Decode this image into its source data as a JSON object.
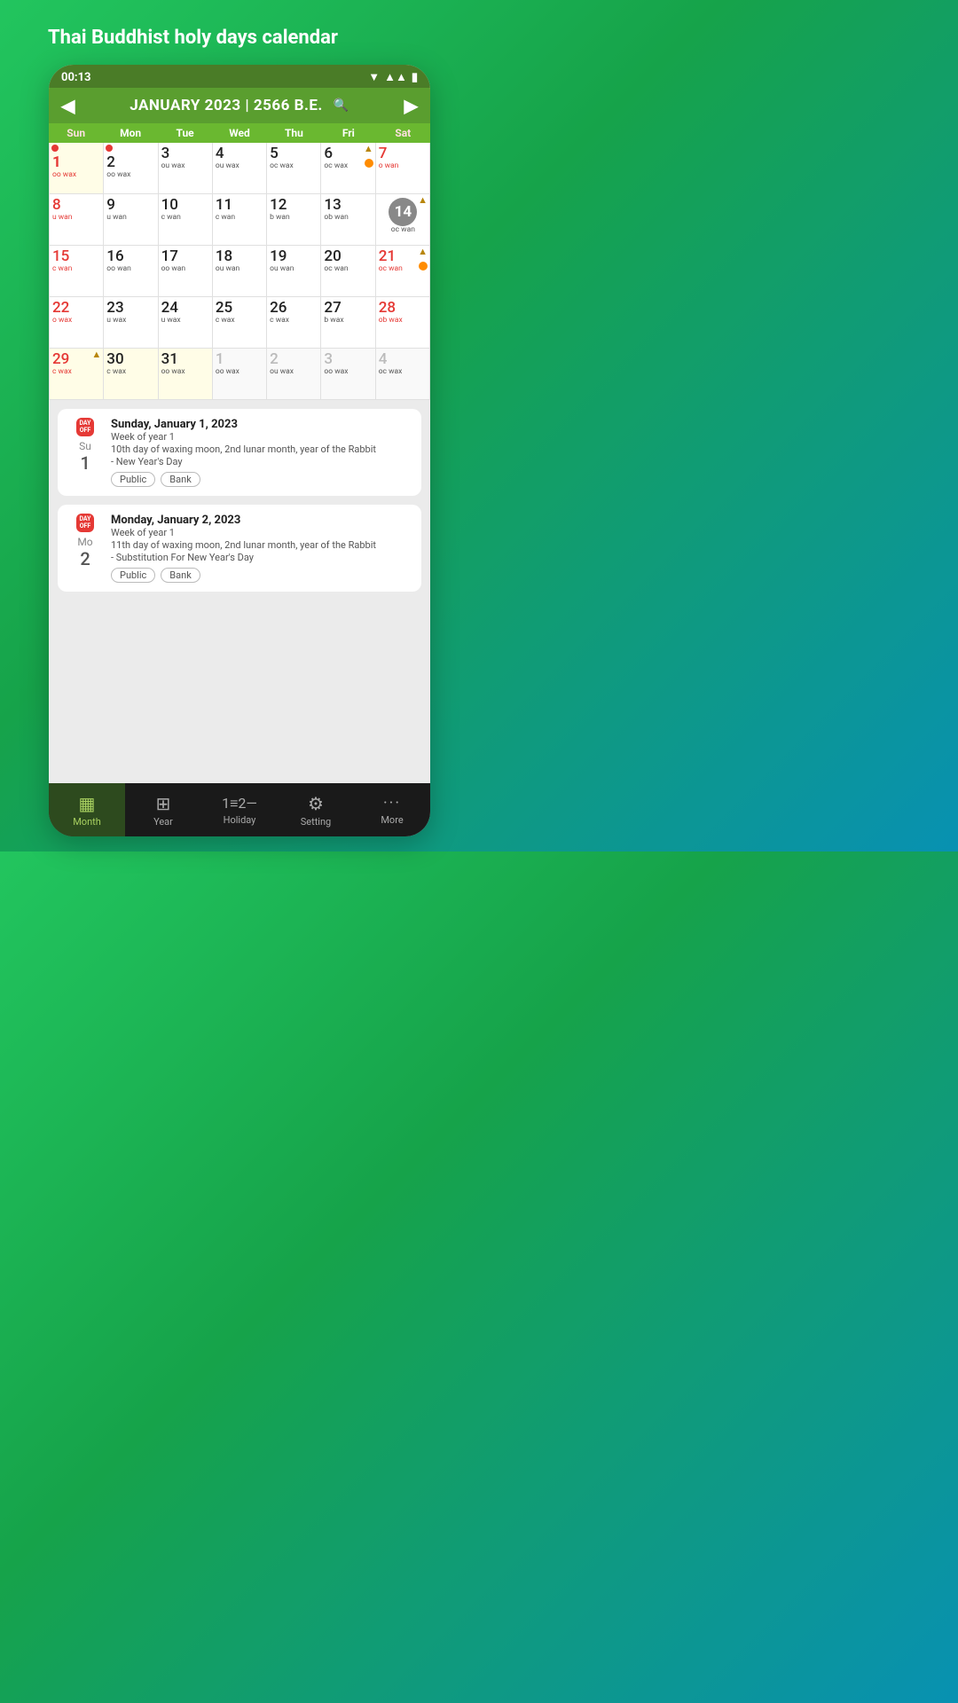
{
  "app": {
    "title": "Thai Buddhist holy days calendar"
  },
  "status_bar": {
    "time": "00:13"
  },
  "calendar": {
    "month_year": "JANUARY 2023 | 2566 B.E.",
    "day_headers": [
      "Sun",
      "Mon",
      "Tue",
      "Wed",
      "Thu",
      "Fri",
      "Sat"
    ],
    "weeks": [
      [
        {
          "num": "1",
          "lunar": "oo wax",
          "red": true,
          "dot": true,
          "yellow": true
        },
        {
          "num": "2",
          "lunar": "oo wax",
          "dot": true
        },
        {
          "num": "3",
          "lunar": "ou wax"
        },
        {
          "num": "4",
          "lunar": "ou wax"
        },
        {
          "num": "5",
          "lunar": "oc wax"
        },
        {
          "num": "6",
          "lunar": "oc wax",
          "triangle": true,
          "orange": true
        },
        {
          "num": "7",
          "lunar": "o wan"
        }
      ],
      [
        {
          "num": "8",
          "lunar": "u wan",
          "red": true
        },
        {
          "num": "9",
          "lunar": "u wan"
        },
        {
          "num": "10",
          "lunar": "c wan"
        },
        {
          "num": "11",
          "lunar": "c wan"
        },
        {
          "num": "12",
          "lunar": "b wan"
        },
        {
          "num": "13",
          "lunar": "ob wan"
        },
        {
          "num": "14",
          "lunar": "oc wan",
          "today": true,
          "triangle": true
        }
      ],
      [
        {
          "num": "15",
          "lunar": "c wan",
          "red": true
        },
        {
          "num": "16",
          "lunar": "oo wan"
        },
        {
          "num": "17",
          "lunar": "oo wan"
        },
        {
          "num": "18",
          "lunar": "ou wan"
        },
        {
          "num": "19",
          "lunar": "ou wan"
        },
        {
          "num": "20",
          "lunar": "oc wan"
        },
        {
          "num": "21",
          "lunar": "oc wan",
          "triangle": true,
          "orange": true
        }
      ],
      [
        {
          "num": "22",
          "lunar": "o wax",
          "red": true
        },
        {
          "num": "23",
          "lunar": "u wax"
        },
        {
          "num": "24",
          "lunar": "u wax"
        },
        {
          "num": "25",
          "lunar": "c wax"
        },
        {
          "num": "26",
          "lunar": "c wax"
        },
        {
          "num": "27",
          "lunar": "b wax"
        },
        {
          "num": "28",
          "lunar": "ob wax"
        }
      ],
      [
        {
          "num": "29",
          "lunar": "c wax",
          "red": true,
          "triangle": true,
          "yellow": true
        },
        {
          "num": "30",
          "lunar": "c wax"
        },
        {
          "num": "31",
          "lunar": "oo wax"
        },
        {
          "num": "1",
          "lunar": "oo wax",
          "grey": true
        },
        {
          "num": "2",
          "lunar": "ou wax",
          "grey": true
        },
        {
          "num": "3",
          "lunar": "oo wax",
          "grey": true
        },
        {
          "num": "4",
          "lunar": "oc wax",
          "grey": true
        }
      ]
    ]
  },
  "events": [
    {
      "day_off": true,
      "day_abbr": "Su",
      "day_num": "1",
      "date_title": "Sunday, January 1, 2023",
      "week_of_year": "Week of year 1",
      "lunar_desc": "10th day of waxing moon, 2nd lunar month, year of the Rabbit",
      "event_name": "- New Year's Day",
      "tags": [
        "Public",
        "Bank"
      ]
    },
    {
      "day_off": true,
      "day_abbr": "Mo",
      "day_num": "2",
      "date_title": "Monday, January 2, 2023",
      "week_of_year": "Week of year 1",
      "lunar_desc": "11th day of waxing moon, 2nd lunar month, year of the Rabbit",
      "event_name": "- Substitution For New Year's Day",
      "tags": [
        "Public",
        "Bank"
      ]
    }
  ],
  "bottom_nav": {
    "items": [
      {
        "label": "Month",
        "icon": "▦",
        "active": true
      },
      {
        "label": "Year",
        "icon": "⊞",
        "active": false
      },
      {
        "label": "Holiday",
        "icon": "≡",
        "active": false
      },
      {
        "label": "Setting",
        "icon": "⚙",
        "active": false
      },
      {
        "label": "More",
        "icon": "•••",
        "active": false
      }
    ]
  }
}
